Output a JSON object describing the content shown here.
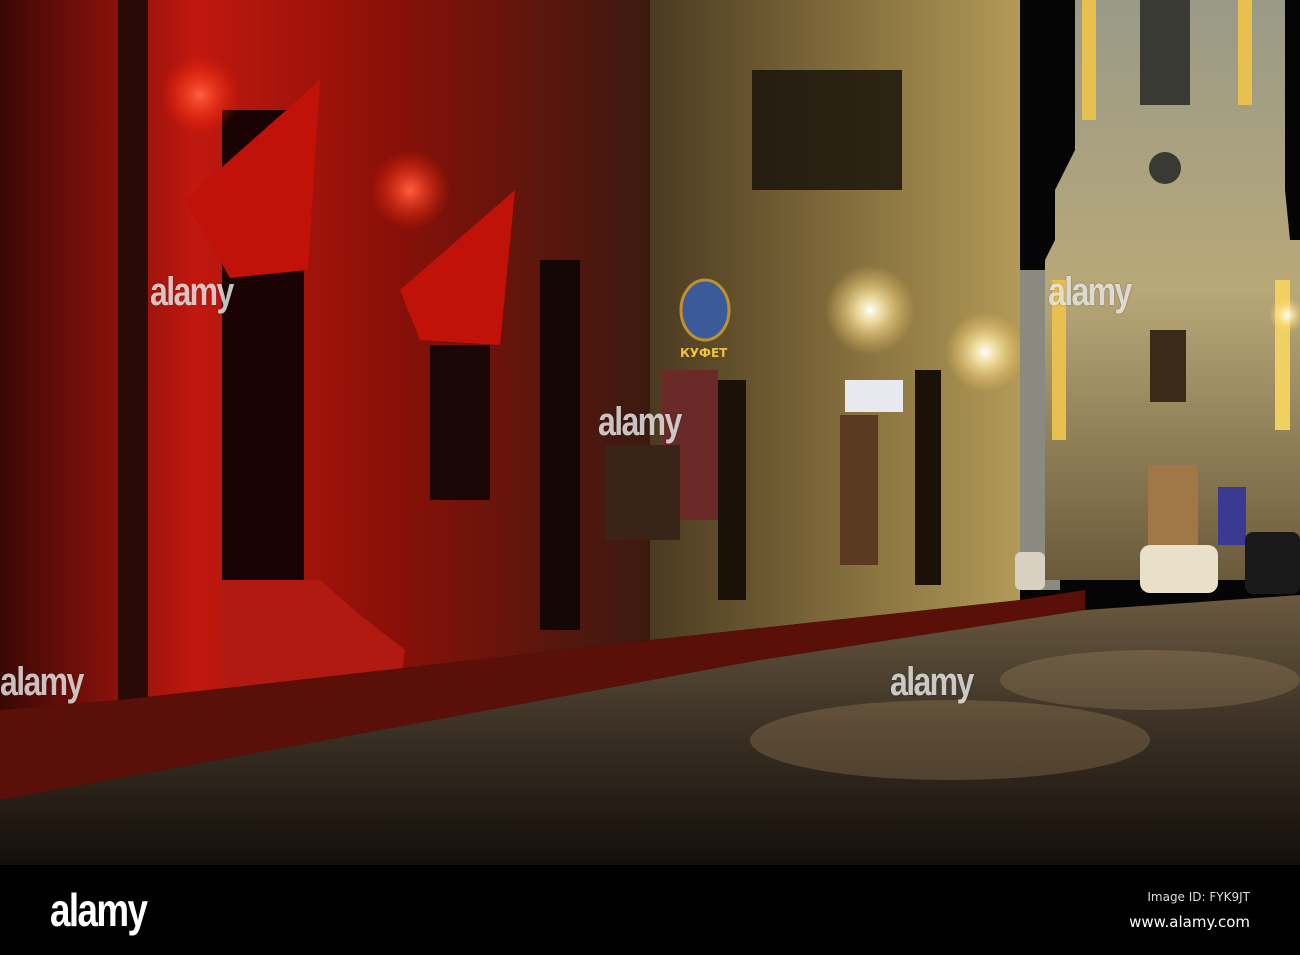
{
  "watermark": {
    "brand": "alamy"
  },
  "footer": {
    "logo": "alamy",
    "image_id": "Image ID: FYK9JT",
    "website": "www.alamy.com"
  },
  "scene": {
    "shop_sign": "КУФЕТ",
    "colors": {
      "red_light": "#e01010",
      "warm_light": "#e8c060",
      "sky": "#050505",
      "cobble": "#3a3024"
    }
  }
}
